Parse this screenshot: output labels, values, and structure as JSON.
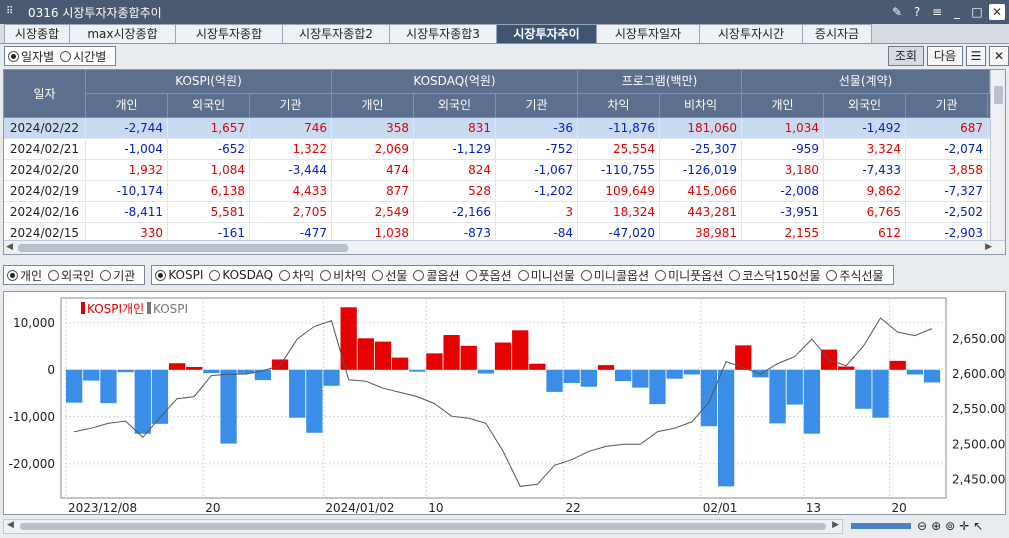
{
  "window": {
    "title": "0316 시장투자자종합추이",
    "buttons": [
      "pin",
      "?",
      "≡",
      "_",
      "□",
      "✕"
    ]
  },
  "tabs": [
    {
      "label": "시장종합",
      "w": 66
    },
    {
      "label": "max시장종합",
      "w": 107
    },
    {
      "label": "시장투자종합",
      "w": 108
    },
    {
      "label": "시장투자종합2",
      "w": 108
    },
    {
      "label": "시장투자종합3",
      "w": 108
    },
    {
      "label": "시장투자추이",
      "w": 101,
      "active": true
    },
    {
      "label": "시장투자일자",
      "w": 104
    },
    {
      "label": "시장투자시간",
      "w": 104
    },
    {
      "label": "증시자금",
      "w": 70
    }
  ],
  "toolbar": {
    "radio_daily": "일자별",
    "radio_time": "시간별",
    "search_btn": "조회",
    "next_btn": "다음"
  },
  "table": {
    "date_header": "일자",
    "groups": [
      "KOSPI(억원)",
      "KOSDAQ(억원)",
      "프로그램(백만)",
      "선물(계약)"
    ],
    "subheaders": [
      "개인",
      "외국인",
      "기관",
      "개인",
      "외국인",
      "기관",
      "차익",
      "비차익",
      "개인",
      "외국인",
      "기관"
    ],
    "rows": [
      {
        "date": "2024/02/22",
        "values": [
          "-2,744",
          "1,657",
          "746",
          "358",
          "831",
          "-36",
          "-11,876",
          "181,060",
          "1,034",
          "-1,492",
          "687"
        ]
      },
      {
        "date": "2024/02/21",
        "values": [
          "-1,004",
          "-652",
          "1,322",
          "2,069",
          "-1,129",
          "-752",
          "25,554",
          "-25,307",
          "-959",
          "3,324",
          "-2,074"
        ]
      },
      {
        "date": "2024/02/20",
        "values": [
          "1,932",
          "1,084",
          "-3,444",
          "474",
          "824",
          "-1,067",
          "-110,755",
          "-126,019",
          "3,180",
          "-7,433",
          "3,858"
        ]
      },
      {
        "date": "2024/02/19",
        "values": [
          "-10,174",
          "6,138",
          "4,433",
          "877",
          "528",
          "-1,202",
          "109,649",
          "415,066",
          "-2,008",
          "9,862",
          "-7,327"
        ]
      },
      {
        "date": "2024/02/16",
        "values": [
          "-8,411",
          "5,581",
          "2,705",
          "2,549",
          "-2,166",
          "3",
          "18,324",
          "443,281",
          "-3,951",
          "6,765",
          "-2,502"
        ]
      },
      {
        "date": "2024/02/15",
        "values": [
          "330",
          "-161",
          "-477",
          "1,038",
          "-873",
          "-84",
          "-47,020",
          "38,981",
          "2,155",
          "612",
          "-2,903"
        ]
      }
    ]
  },
  "selectors": {
    "investor": [
      {
        "label": "개인",
        "on": true
      },
      {
        "label": "외국인"
      },
      {
        "label": "기관"
      }
    ],
    "market": [
      {
        "label": "KOSPI",
        "on": true
      },
      {
        "label": "KOSDAQ"
      },
      {
        "label": "차익"
      },
      {
        "label": "비차익"
      },
      {
        "label": "선물"
      },
      {
        "label": "콜옵션"
      },
      {
        "label": "풋옵션"
      },
      {
        "label": "미니선물"
      },
      {
        "label": "미니콜옵션"
      },
      {
        "label": "미니풋옵션"
      },
      {
        "label": "코스닥150선물"
      },
      {
        "label": "주식선물"
      }
    ]
  },
  "chart_data": {
    "type": "bar",
    "legend": [
      {
        "name": "KOSPI개인",
        "color": "#e00000"
      },
      {
        "name": "KOSPI",
        "color": "#777777"
      }
    ],
    "left_axis": {
      "ticks": [
        "10,000",
        "0",
        "-10,000",
        "-20,000"
      ],
      "values": [
        10000,
        0,
        -10000,
        -20000
      ],
      "range": [
        -26000,
        14000
      ]
    },
    "right_axis": {
      "ticks": [
        "2,650.00",
        "2,600.00",
        "2,550.00",
        "2,500.00",
        "2,450.00"
      ],
      "values": [
        2650,
        2600,
        2550,
        2500,
        2450
      ],
      "range": [
        2432,
        2700
      ]
    },
    "x_labels": [
      {
        "label": "2023/12/08",
        "i": 0
      },
      {
        "label": "20",
        "i": 8
      },
      {
        "label": "2024/01/02",
        "i": 15
      },
      {
        "label": "10",
        "i": 21
      },
      {
        "label": "22",
        "i": 29
      },
      {
        "label": "02/01",
        "i": 37
      },
      {
        "label": "13",
        "i": 43
      },
      {
        "label": "20",
        "i": 48
      }
    ],
    "bars": [
      -7000,
      -2300,
      -7100,
      -500,
      -13600,
      -11500,
      1400,
      600,
      -700,
      -15700,
      -800,
      -2200,
      2200,
      -10200,
      -13400,
      -3400,
      13300,
      6700,
      6000,
      2600,
      -400,
      3500,
      7400,
      5100,
      -800,
      5800,
      8400,
      1300,
      -4700,
      -2800,
      -3600,
      1000,
      -2400,
      -3800,
      -7300,
      -1900,
      -1000,
      -12000,
      -24800,
      5200,
      -1600,
      -11400,
      -7400,
      -13600,
      4300,
      700,
      -8300,
      -10200,
      1900,
      -1000,
      -2700
    ],
    "index": [
      2518,
      2523,
      2530,
      2533,
      2510,
      2538,
      2565,
      2568,
      2598,
      2600,
      2600,
      2605,
      2612,
      2650,
      2668,
      2676,
      2592,
      2590,
      2580,
      2574,
      2568,
      2558,
      2540,
      2537,
      2530,
      2490,
      2440,
      2443,
      2470,
      2478,
      2490,
      2497,
      2500,
      2500,
      2518,
      2523,
      2532,
      2560,
      2618,
      2609,
      2600,
      2615,
      2625,
      2650,
      2620,
      2612,
      2640,
      2680,
      2660,
      2655,
      2665
    ]
  }
}
